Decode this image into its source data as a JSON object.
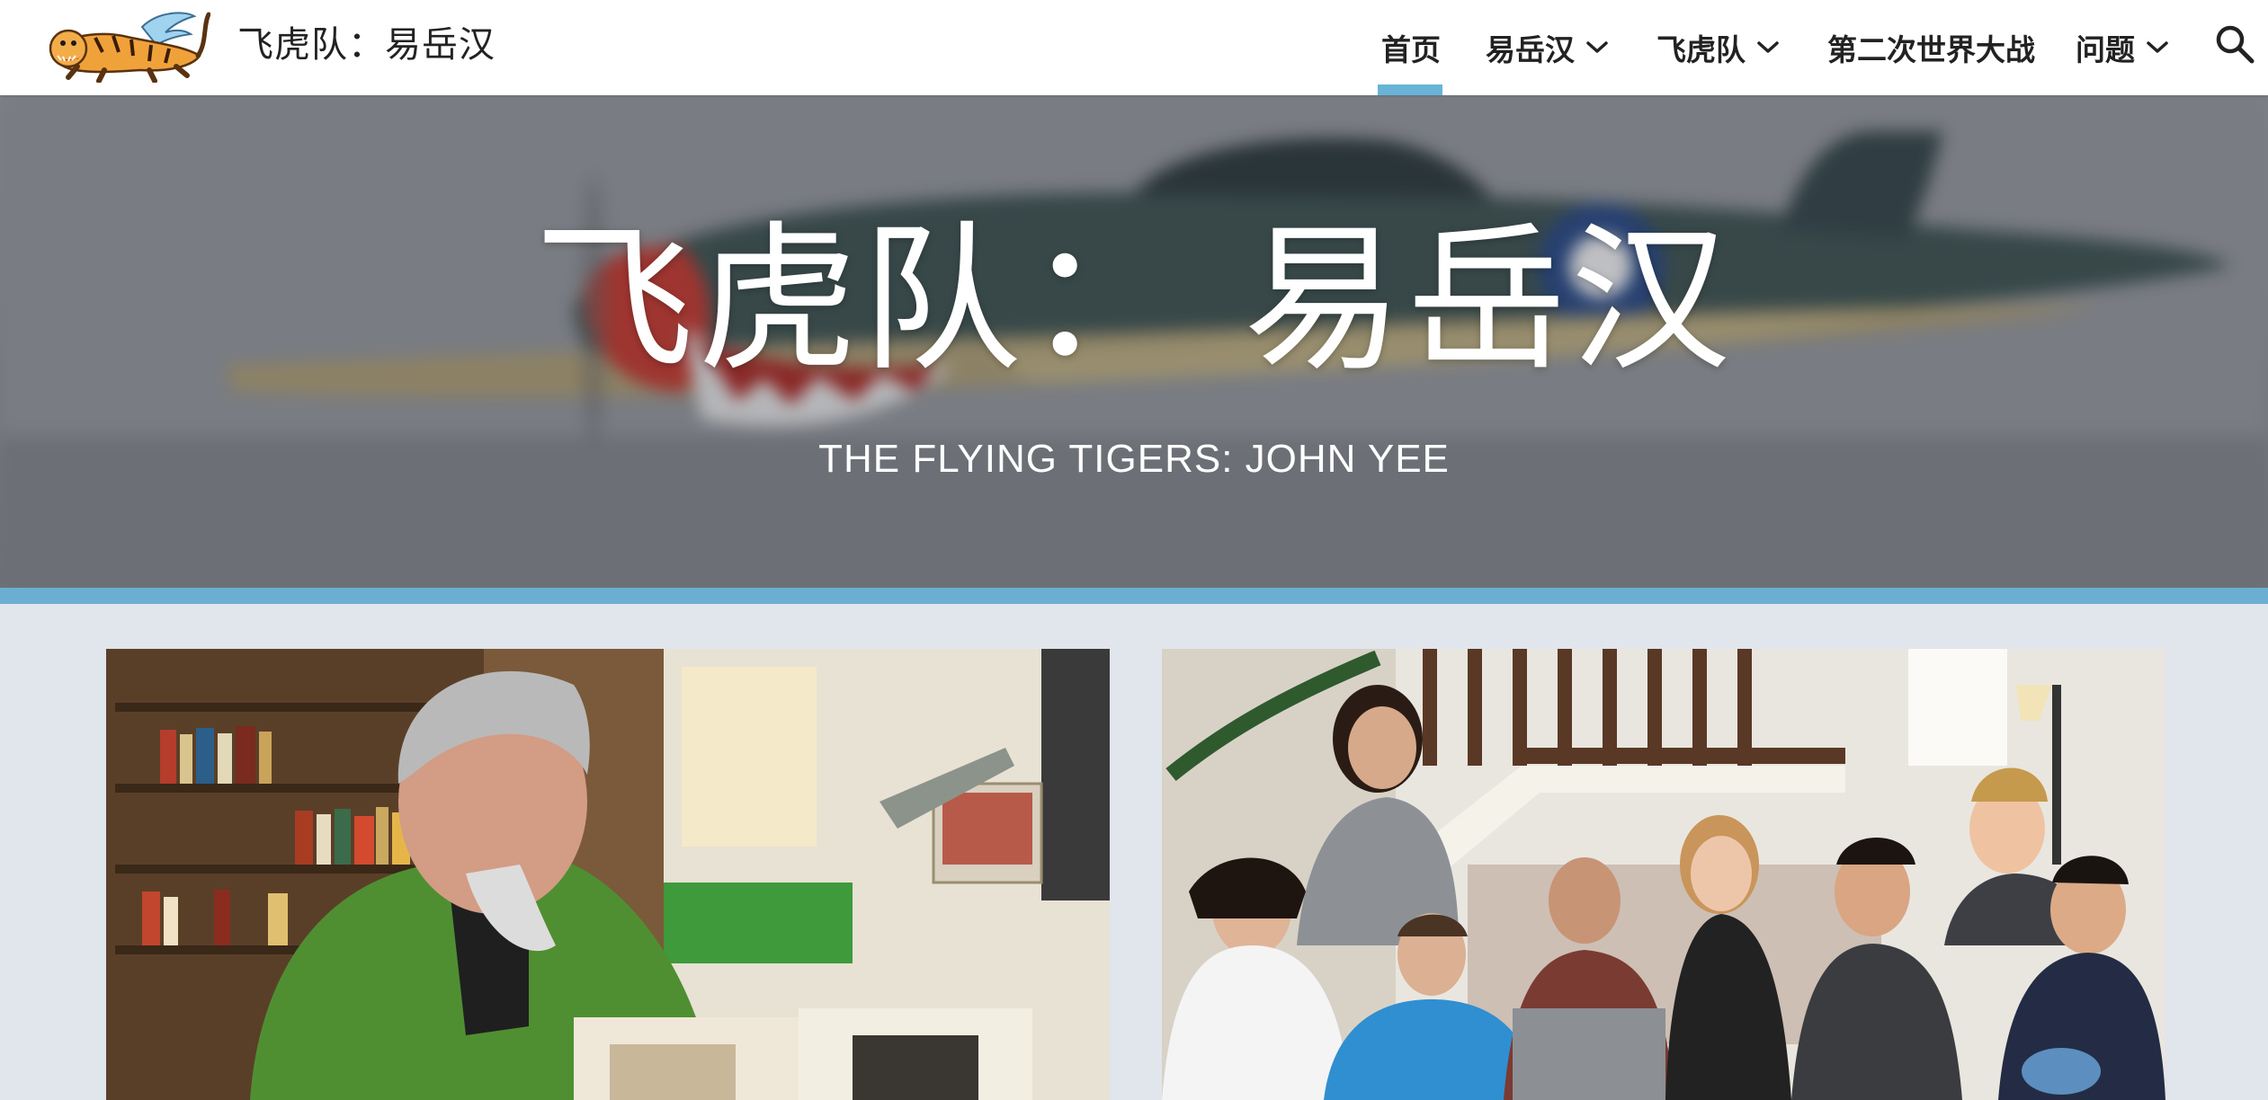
{
  "site": {
    "title": "飞虎队：易岳汉"
  },
  "nav": {
    "items": [
      {
        "label": "首页",
        "active": true,
        "has_dropdown": false
      },
      {
        "label": "易岳汉",
        "active": false,
        "has_dropdown": true
      },
      {
        "label": "飞虎队",
        "active": false,
        "has_dropdown": true
      },
      {
        "label": "第二次世界大战",
        "active": false,
        "has_dropdown": false
      },
      {
        "label": "问题",
        "active": false,
        "has_dropdown": true
      }
    ],
    "search_icon": "search-icon"
  },
  "hero": {
    "title": "飞虎队：  易岳汉",
    "subtitle": "THE FLYING TIGERS: JOHN YEE"
  },
  "colors": {
    "accent": "#67b4d6",
    "page_background": "#e1e5ec",
    "nav_background": "#ffffff"
  }
}
